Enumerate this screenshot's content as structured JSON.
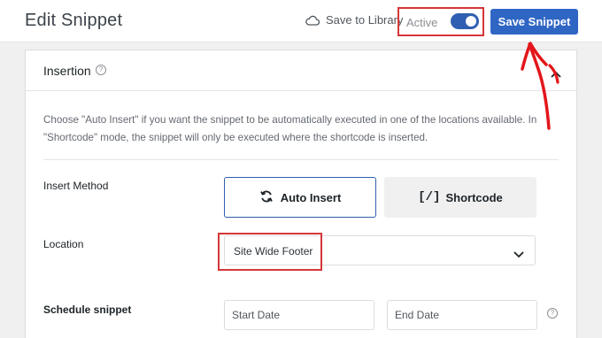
{
  "header": {
    "title": "Edit Snippet",
    "save_to_library_label": "Save to Library",
    "active_label": "Active",
    "active_toggle_on": true,
    "save_button_label": "Save Snippet"
  },
  "insertion": {
    "title": "Insertion",
    "help_glyph": "?",
    "description": "Choose \"Auto Insert\" if you want the snippet to be automatically executed in one of the locations available. In \"Shortcode\" mode, the snippet will only be executed where the shortcode is inserted.",
    "insert_method_label": "Insert Method",
    "auto_insert_label": "Auto Insert",
    "shortcode_label": "Shortcode",
    "shortcode_glyph": "[/]",
    "location_label": "Location",
    "location_value": "Site Wide Footer",
    "schedule_label": "Schedule snippet",
    "start_date_placeholder": "Start Date",
    "end_date_placeholder": "End Date"
  },
  "colors": {
    "primary": "#2f66c4",
    "highlight": "#d63638",
    "annotation_arrow": "#e3161b"
  }
}
